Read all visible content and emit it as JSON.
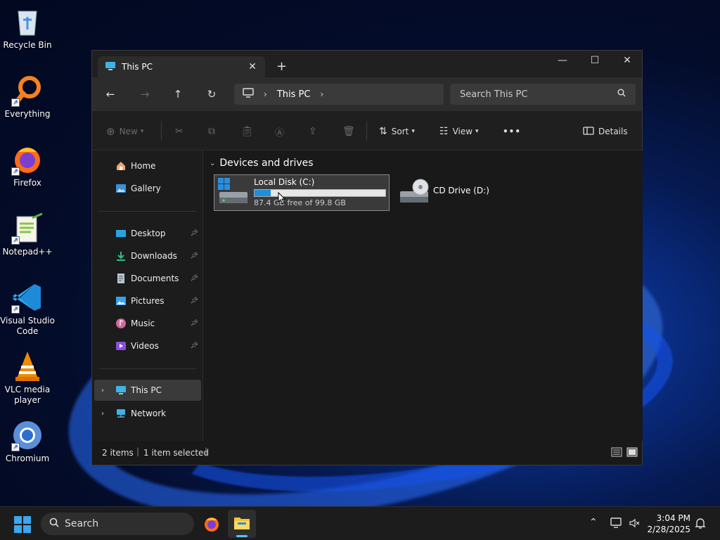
{
  "desktop": {
    "icons": [
      {
        "label": "Recycle Bin",
        "icon": "recycle-bin-icon"
      },
      {
        "label": "Everything",
        "icon": "everything-search-icon"
      },
      {
        "label": "Firefox",
        "icon": "firefox-icon"
      },
      {
        "label": "Notepad++",
        "icon": "notepadpp-icon"
      },
      {
        "label": "Visual Studio Code",
        "icon": "vscode-icon"
      },
      {
        "label": "VLC media player",
        "icon": "vlc-icon"
      },
      {
        "label": "Chromium",
        "icon": "chromium-icon"
      }
    ]
  },
  "window": {
    "tab_title": "This PC",
    "new_tab_symbol": "+",
    "address": {
      "segment": "This PC"
    },
    "search": {
      "placeholder": "Search This PC"
    },
    "toolbar": {
      "new_label": "New",
      "sort_label": "Sort",
      "view_label": "View",
      "more_label": "•••",
      "details_label": "Details"
    },
    "sidebar": {
      "top": [
        {
          "label": "Home"
        },
        {
          "label": "Gallery"
        }
      ],
      "pinned": [
        {
          "label": "Desktop"
        },
        {
          "label": "Downloads"
        },
        {
          "label": "Documents"
        },
        {
          "label": "Pictures"
        },
        {
          "label": "Music"
        },
        {
          "label": "Videos"
        }
      ],
      "tree": [
        {
          "label": "This PC",
          "selected": true
        },
        {
          "label": "Network",
          "selected": false
        }
      ]
    },
    "content": {
      "group_title": "Devices and drives",
      "drives": [
        {
          "name": "Local Disk (C:)",
          "free_text": "87.4 GB free of 99.8 GB",
          "used_fraction": 0.124
        },
        {
          "name": "CD Drive (D:)"
        }
      ]
    },
    "status": {
      "items": "2 items",
      "selected": "1 item selected"
    }
  },
  "taskbar": {
    "search_label": "Search",
    "time": "3:04 PM",
    "date": "2/28/2025"
  },
  "colors": {
    "accent": "#1e8fd8",
    "window_bg": "#191919",
    "taskbar_bg": "#1c1c1c"
  }
}
